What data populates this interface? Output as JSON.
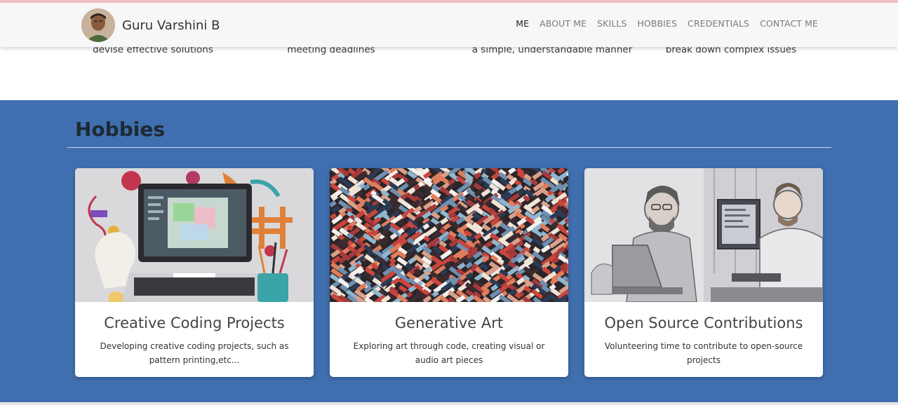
{
  "brand": {
    "name": "Guru Varshini B"
  },
  "nav": {
    "items": [
      {
        "label": "ME",
        "active": true
      },
      {
        "label": "ABOUT ME",
        "active": false
      },
      {
        "label": "SKILLS",
        "active": false
      },
      {
        "label": "HOBBIES",
        "active": false
      },
      {
        "label": "CREDENTIALS",
        "active": false
      },
      {
        "label": "CONTACT ME",
        "active": false
      }
    ]
  },
  "skills_strip": [
    "devise effective solutions",
    "meeting deadlines",
    "a simple, understandable manner",
    "break down complex issues"
  ],
  "hobbies": {
    "title": "Hobbies",
    "cards": [
      {
        "title": "Creative Coding Projects",
        "text": "Developing creative coding projects, such as pattern printing,etc..."
      },
      {
        "title": "Generative Art",
        "text": "Exploring art through code, creating visual or audio art pieces"
      },
      {
        "title": "Open Source Contributions",
        "text": "Volunteering time to contribute to open-source projects"
      }
    ]
  },
  "colors": {
    "section_bg": "#3f6fae",
    "navbar_bg": "#f8f7f8",
    "top_accent": "#f6c3cc"
  }
}
